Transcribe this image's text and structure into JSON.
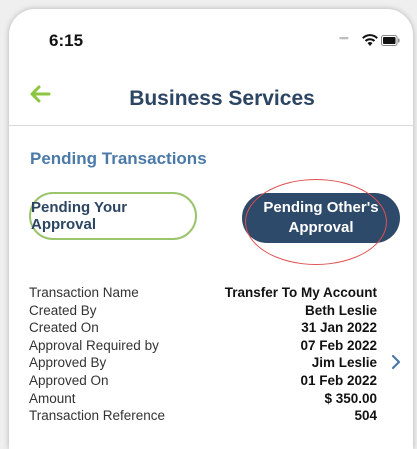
{
  "status": {
    "time": "6:15"
  },
  "header": {
    "title": "Business Services"
  },
  "section": {
    "title": "Pending Transactions"
  },
  "tabs": {
    "your_approval": "Pending Your Approval",
    "others_approval_line1": "Pending Other's",
    "others_approval_line2": "Approval"
  },
  "transaction": [
    {
      "label": "Transaction Name",
      "value": "Transfer To My Account"
    },
    {
      "label": "Created By",
      "value": "Beth Leslie"
    },
    {
      "label": "Created On",
      "value": "31 Jan 2022"
    },
    {
      "label": "Approval Required by",
      "value": "07 Feb 2022"
    },
    {
      "label": "Approved By",
      "value": "Jim Leslie"
    },
    {
      "label": "Approved On",
      "value": "01 Feb 2022"
    },
    {
      "label": "Amount",
      "value": "$ 350.00"
    },
    {
      "label": "Transaction Reference",
      "value": "504"
    }
  ],
  "colors": {
    "title": "#2b4563",
    "section_title": "#4b7aa9",
    "accent_green": "#8cc63f",
    "active_tab": "#2e4a6b",
    "highlight": "#e05050"
  }
}
